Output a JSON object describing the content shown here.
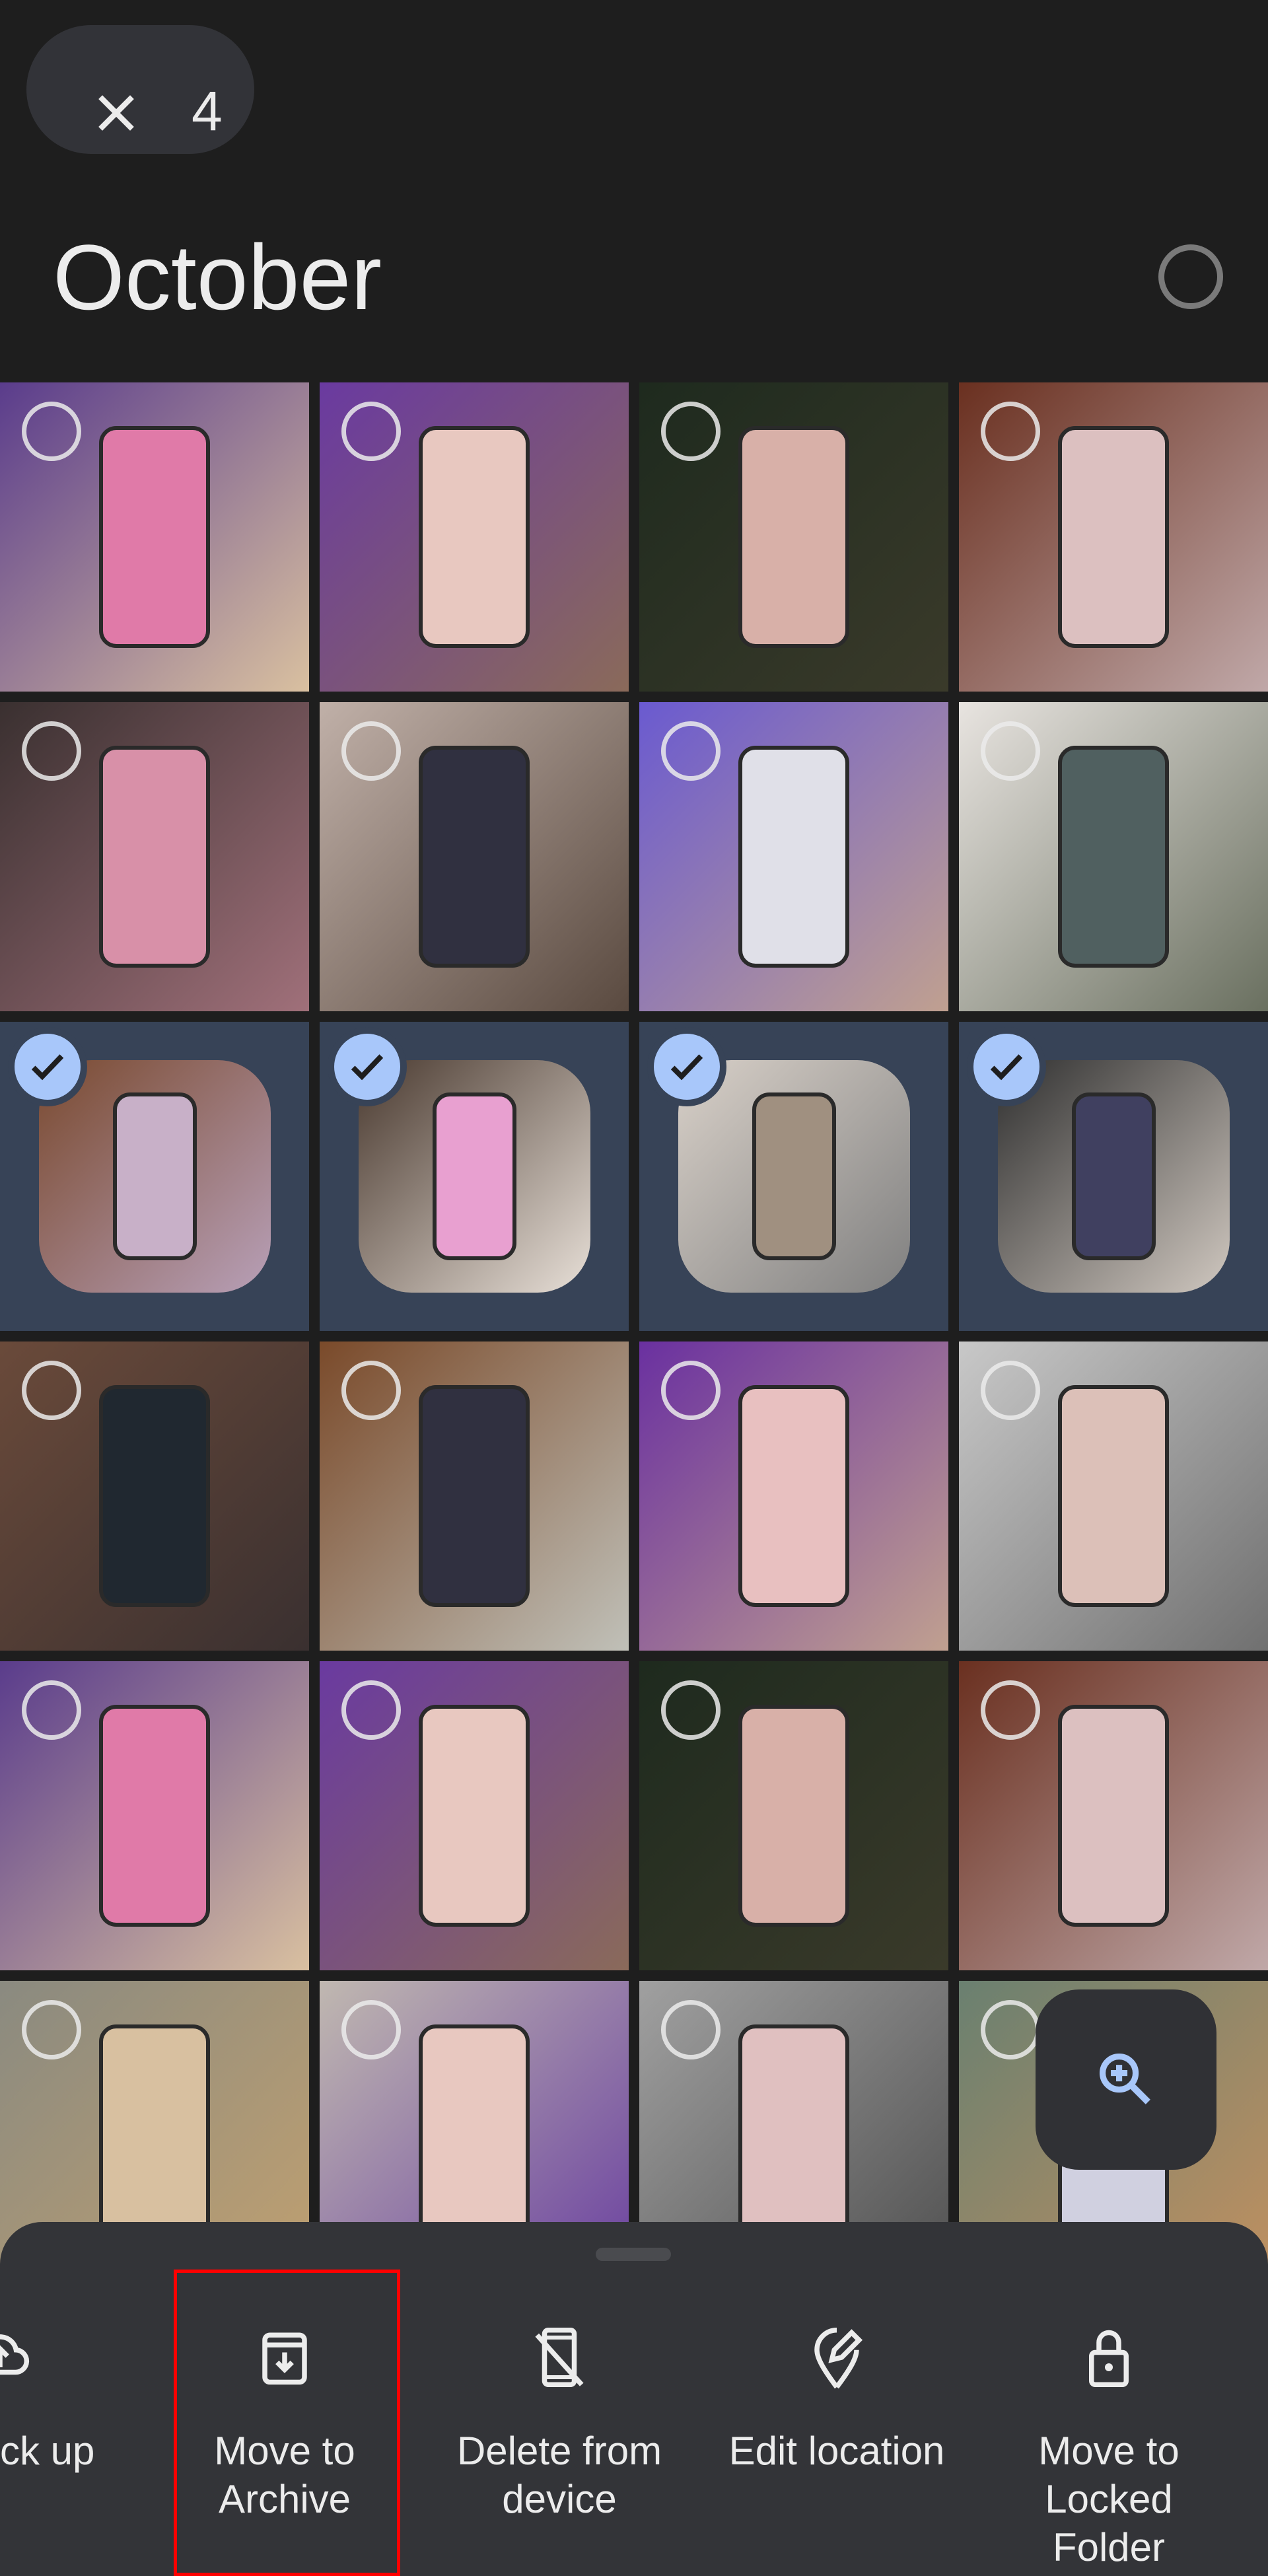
{
  "selection_bar": {
    "close_icon": "close-icon",
    "selected_count": "4"
  },
  "section": {
    "title": "October",
    "select_all_icon": "circle-outline-icon"
  },
  "colors": {
    "background": "#1e1e1e",
    "selected_tile_bg": "#374357",
    "check_accent": "#a8c7fa",
    "sheet_bg": "#333438",
    "highlight": "#ff0000"
  },
  "grid": {
    "tiles": [
      {
        "selected": false,
        "c1": "#5a3c8c",
        "c2": "#d9c0a0",
        "phone": "#e07aa8"
      },
      {
        "selected": false,
        "c1": "#6a3aa0",
        "c2": "#8a6a5a",
        "phone": "#e8c8c0"
      },
      {
        "selected": false,
        "c1": "#1e2a1e",
        "c2": "#3a3a2a",
        "phone": "#d8b0a8"
      },
      {
        "selected": false,
        "c1": "#6a3020",
        "c2": "#c0a8a8",
        "phone": "#dcc0c0"
      },
      {
        "selected": false,
        "c1": "#3a3030",
        "c2": "#a0707a",
        "phone": "#d890a8"
      },
      {
        "selected": false,
        "c1": "#c0b0a8",
        "c2": "#5a4a40",
        "phone": "#303040"
      },
      {
        "selected": false,
        "c1": "#6a5ad0",
        "c2": "#c0a090",
        "phone": "#e0e0e8"
      },
      {
        "selected": false,
        "c1": "#e8e4e0",
        "c2": "#6a7060",
        "phone": "#506060"
      },
      {
        "selected": true,
        "c1": "#7a4a30",
        "c2": "#b8a0b8",
        "phone": "#c8b0c8"
      },
      {
        "selected": true,
        "c1": "#4a3a30",
        "c2": "#e8e0d8",
        "phone": "#e8a0d0"
      },
      {
        "selected": true,
        "c1": "#d8d0c8",
        "c2": "#808080",
        "phone": "#a09080"
      },
      {
        "selected": true,
        "c1": "#303030",
        "c2": "#d0c8c0",
        "phone": "#404060"
      },
      {
        "selected": false,
        "c1": "#6a4a3a",
        "c2": "#3a3030",
        "phone": "#202830"
      },
      {
        "selected": false,
        "c1": "#7a4a2a",
        "c2": "#c0c0b8",
        "phone": "#303040"
      },
      {
        "selected": false,
        "c1": "#6a30a0",
        "c2": "#c0a090",
        "phone": "#e8c0c0"
      },
      {
        "selected": false,
        "c1": "#c8c8c8",
        "c2": "#707070",
        "phone": "#dcc0b8"
      },
      {
        "selected": false,
        "c1": "#5a3c8c",
        "c2": "#d9c0a0",
        "phone": "#e07aa8"
      },
      {
        "selected": false,
        "c1": "#6a3aa0",
        "c2": "#8a6a5a",
        "phone": "#e8c8c0"
      },
      {
        "selected": false,
        "c1": "#1e2a1e",
        "c2": "#3a3a2a",
        "phone": "#d8b0a8"
      },
      {
        "selected": false,
        "c1": "#6a3020",
        "c2": "#c0a8a8",
        "phone": "#dcc0c0"
      },
      {
        "selected": false,
        "c1": "#8a8a80",
        "c2": "#c0a070",
        "phone": "#d8c0a0"
      },
      {
        "selected": false,
        "c1": "#c0b8b0",
        "c2": "#6a40a0",
        "phone": "#e8c8c0"
      },
      {
        "selected": false,
        "c1": "#a0a0a0",
        "c2": "#505050",
        "phone": "#e0c0c0"
      },
      {
        "selected": false,
        "c1": "#6a8070",
        "c2": "#c09060",
        "phone": "#d0d0e0"
      }
    ]
  },
  "zoom_button": {
    "icon": "zoom-in-icon"
  },
  "action_sheet": {
    "actions": [
      {
        "label": "ck up",
        "icon": "cloud-upload-icon"
      },
      {
        "label": "Move to Archive",
        "icon": "archive-icon",
        "highlighted": true
      },
      {
        "label": "Delete from device",
        "icon": "phone-off-icon"
      },
      {
        "label": "Edit location",
        "icon": "edit-location-icon"
      },
      {
        "label": "Move to Locked Folder",
        "icon": "lock-icon"
      }
    ]
  }
}
